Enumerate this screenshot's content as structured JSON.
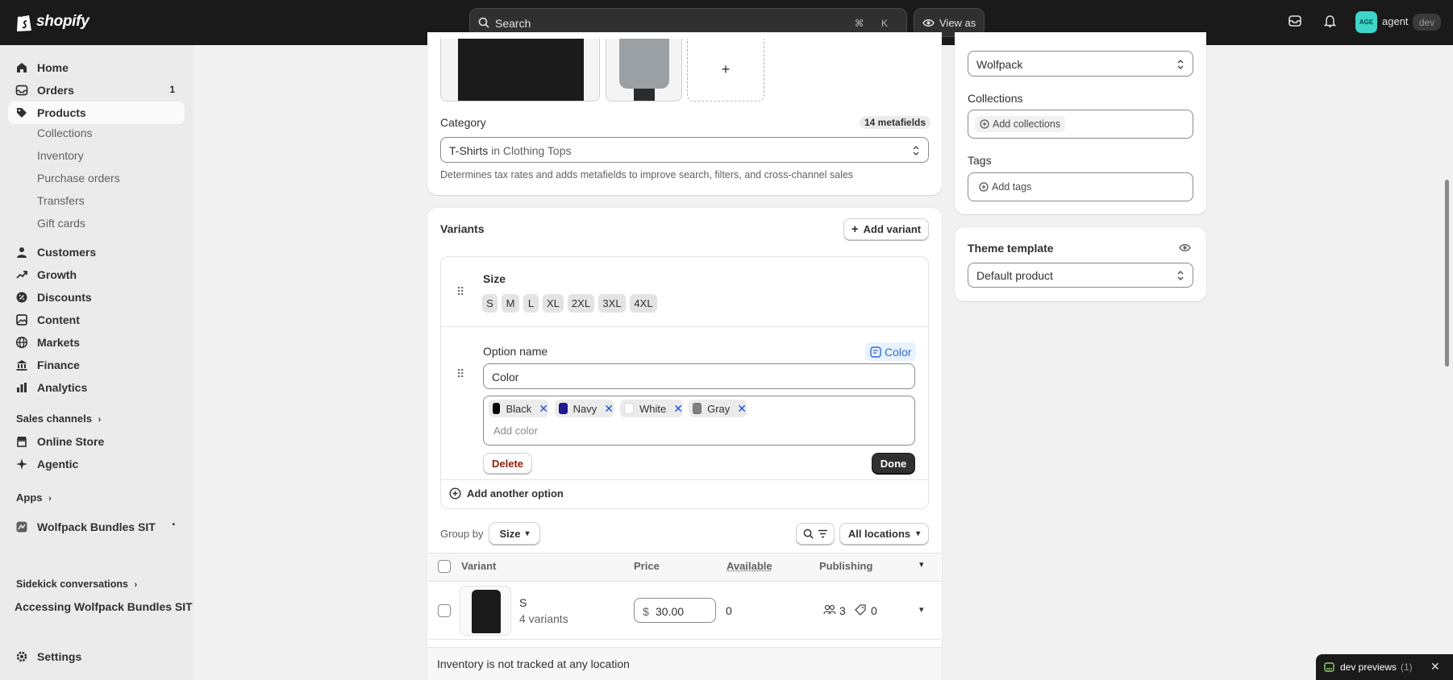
{
  "topbar": {
    "brand": "shopify",
    "search_placeholder": "Search",
    "search_shortcut": "⌘ K",
    "view_as_label": "View as",
    "avatar_initials": "AGE",
    "user_name": "agent",
    "store_badge": "dev"
  },
  "sidebar": {
    "items": [
      {
        "label": "Home",
        "icon": "home-icon"
      },
      {
        "label": "Orders",
        "icon": "orders-icon",
        "badge": "1"
      },
      {
        "label": "Products",
        "icon": "tag-icon"
      },
      {
        "label": "Customers",
        "icon": "person-icon"
      },
      {
        "label": "Growth",
        "icon": "growth-icon"
      },
      {
        "label": "Discounts",
        "icon": "discount-icon"
      },
      {
        "label": "Content",
        "icon": "content-icon"
      },
      {
        "label": "Markets",
        "icon": "globe-icon"
      },
      {
        "label": "Finance",
        "icon": "bank-icon"
      },
      {
        "label": "Analytics",
        "icon": "chart-icon"
      }
    ],
    "product_subitems": [
      "Collections",
      "Inventory",
      "Purchase orders",
      "Transfers",
      "Gift cards"
    ],
    "sales_channels_label": "Sales channels",
    "sales_channels": [
      {
        "label": "Online Store",
        "icon": "store-icon"
      },
      {
        "label": "Agentic",
        "icon": "agentic-icon"
      }
    ],
    "apps_label": "Apps",
    "apps": [
      {
        "label": "Wolfpack Bundles SIT",
        "icon": "app-icon"
      }
    ],
    "sidekick_label": "Sidekick conversations",
    "sidekick_item": "Accessing Wolfpack Bundles SIT",
    "settings_label": "Settings"
  },
  "category_card": {
    "label": "Category",
    "metafields": "14 metafields",
    "value_main": "T-Shirts",
    "value_in": "in",
    "value_path": "Clothing Tops",
    "help": "Determines tax rates and adds metafields to improve search, filters, and cross-channel sales"
  },
  "variants_card": {
    "title": "Variants",
    "add_variant": "Add variant",
    "size_option": {
      "name": "Size",
      "values": [
        "S",
        "M",
        "L",
        "XL",
        "2XL",
        "3XL",
        "4XL"
      ]
    },
    "color_option": {
      "option_name_label": "Option name",
      "metafield_link": "Color",
      "name_value": "Color",
      "values": [
        {
          "label": "Black",
          "color": "#000000"
        },
        {
          "label": "Navy",
          "color": "#1f1a8f"
        },
        {
          "label": "White",
          "color": "#ffffff"
        },
        {
          "label": "Gray",
          "color": "#808080"
        }
      ],
      "add_placeholder": "Add color",
      "delete_label": "Delete",
      "done_label": "Done"
    },
    "add_another_option": "Add another option",
    "group_by_label": "Group by",
    "group_by_value": "Size",
    "locations_value": "All locations",
    "columns": [
      "Variant",
      "Price",
      "Available",
      "Publishing"
    ],
    "rows": [
      {
        "name": "S",
        "sub": "4 variants",
        "currency": "$",
        "price": "30.00",
        "available": "0",
        "publish_a": "3",
        "publish_b": "0"
      }
    ],
    "footer_notice": "Inventory is not tracked at any location"
  },
  "right_col": {
    "vendor_value": "Wolfpack",
    "collections_label": "Collections",
    "add_collections": "Add collections",
    "tags_label": "Tags",
    "add_tags": "Add tags",
    "theme_template_label": "Theme template",
    "theme_template_value": "Default product"
  },
  "dev_previews": {
    "label": "dev previews",
    "count": "(1)"
  }
}
